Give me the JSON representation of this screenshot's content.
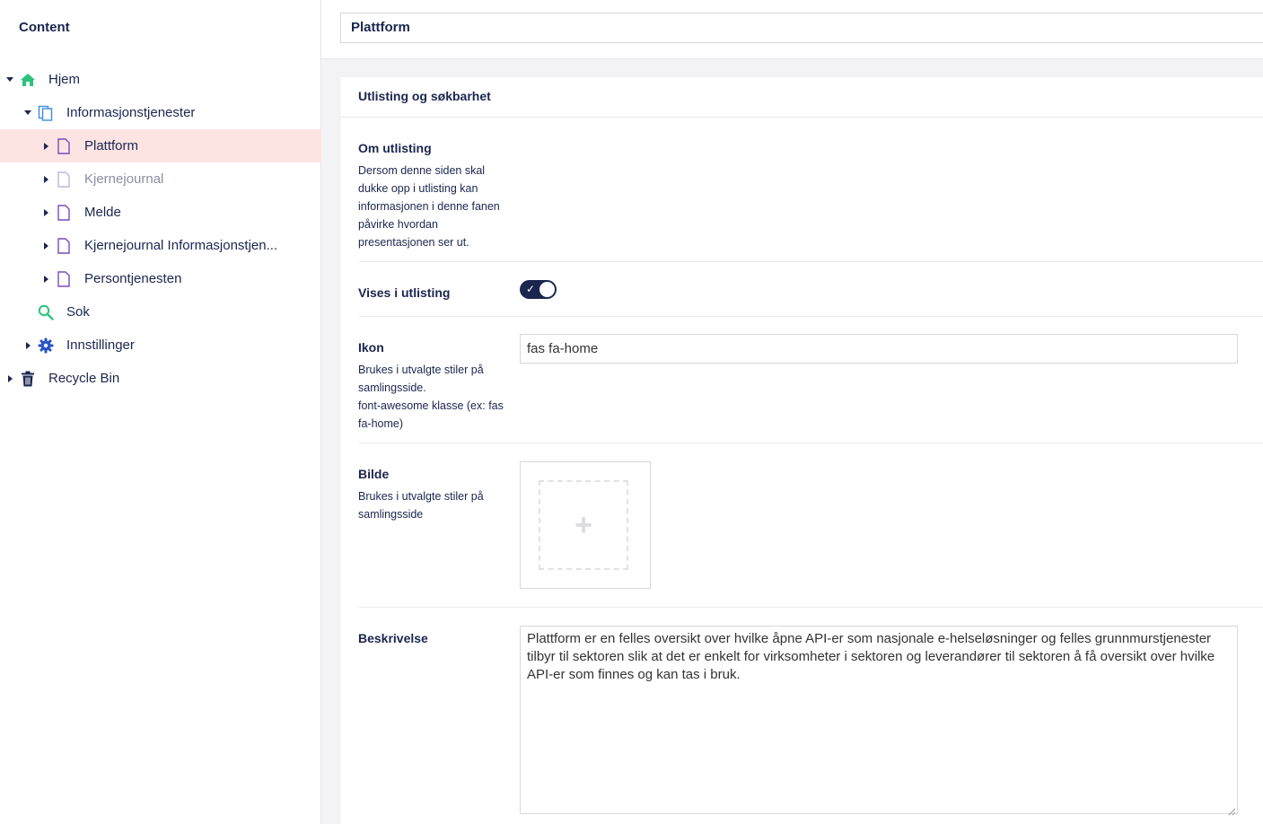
{
  "sidebar": {
    "title": "Content",
    "items": [
      {
        "label": "Hjem",
        "icon": "home-icon"
      },
      {
        "label": "Informasjonstjenester",
        "icon": "document-stack-icon"
      },
      {
        "label": "Plattform",
        "icon": "document-icon"
      },
      {
        "label": "Kjernejournal",
        "icon": "document-icon"
      },
      {
        "label": "Melde",
        "icon": "document-icon"
      },
      {
        "label": "Kjernejournal Informasjonstjen...",
        "icon": "document-icon"
      },
      {
        "label": "Persontjenesten",
        "icon": "document-icon"
      },
      {
        "label": "Sok",
        "icon": "search-icon"
      },
      {
        "label": "Innstillinger",
        "icon": "gear-icon"
      },
      {
        "label": "Recycle Bin",
        "icon": "trash-icon"
      }
    ]
  },
  "page": {
    "name_value": "Plattform"
  },
  "panel": {
    "title": "Utlisting og søkbarhet",
    "om_utlisting": {
      "label": "Om utlisting",
      "description": "Dersom denne siden skal dukke opp i utlisting kan informasjonen i denne fanen påvirke hvordan presentasjonen ser ut."
    },
    "vises_i_utlisting": {
      "label": "Vises i utlisting",
      "checked": true
    },
    "ikon": {
      "label": "Ikon",
      "description_1": "Brukes i utvalgte stiler på samlingsside.",
      "description_2": "font-awesome klasse (ex: fas fa-home)",
      "value": "fas fa-home"
    },
    "bilde": {
      "label": "Bilde",
      "description": "Brukes i utvalgte stiler på samlingsside"
    },
    "beskrivelse": {
      "label": "Beskrivelse",
      "value": "Plattform er en felles oversikt over hvilke åpne API-er som nasjonale e-helseløsninger og felles grunnmurstjenester tilbyr til sektoren slik at det er enkelt for virksomheter i sektoren og leverandører til sektoren å få oversikt over hvilke API-er som finnes og kan tas i bruk."
    }
  },
  "colors": {
    "primary": "#1b264f",
    "active_row": "#fde4e3",
    "home_green": "#2bc37c",
    "search_green": "#2bc37c",
    "doc_purple": "#7a4bb8",
    "doc_blue": "#3b8de0"
  }
}
